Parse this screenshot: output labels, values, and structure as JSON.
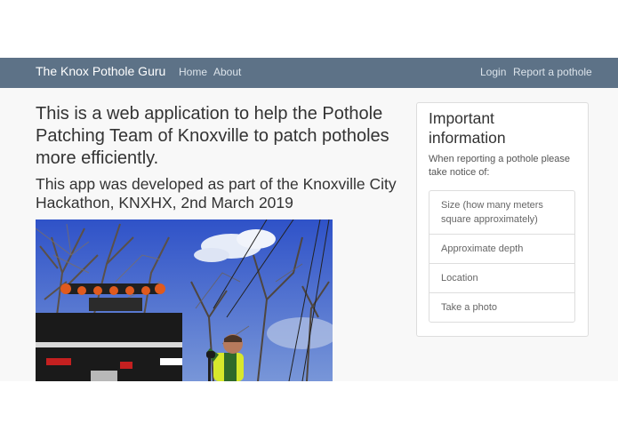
{
  "navbar": {
    "brand": "The Knox Pothole Guru",
    "links": [
      {
        "label": "Home"
      },
      {
        "label": "About"
      }
    ],
    "right_links": [
      {
        "label": "Login"
      },
      {
        "label": "Report a pothole"
      }
    ],
    "background_color": "#5d7287"
  },
  "main": {
    "heading": "This is a web application to help the Pothole Patching Team of Knoxville to patch potholes more efficiently.",
    "subheading": "This app was developed as part of the Knoxville City Hackathon, KNXHX, 2nd March 2019"
  },
  "info_panel": {
    "title": "Important information",
    "intro": "When reporting a pothole please take notice of:",
    "items": [
      {
        "label": "Size (how many meters square approximately)"
      },
      {
        "label": "Approximate depth"
      },
      {
        "label": "Location"
      },
      {
        "label": "Take a photo"
      }
    ]
  }
}
